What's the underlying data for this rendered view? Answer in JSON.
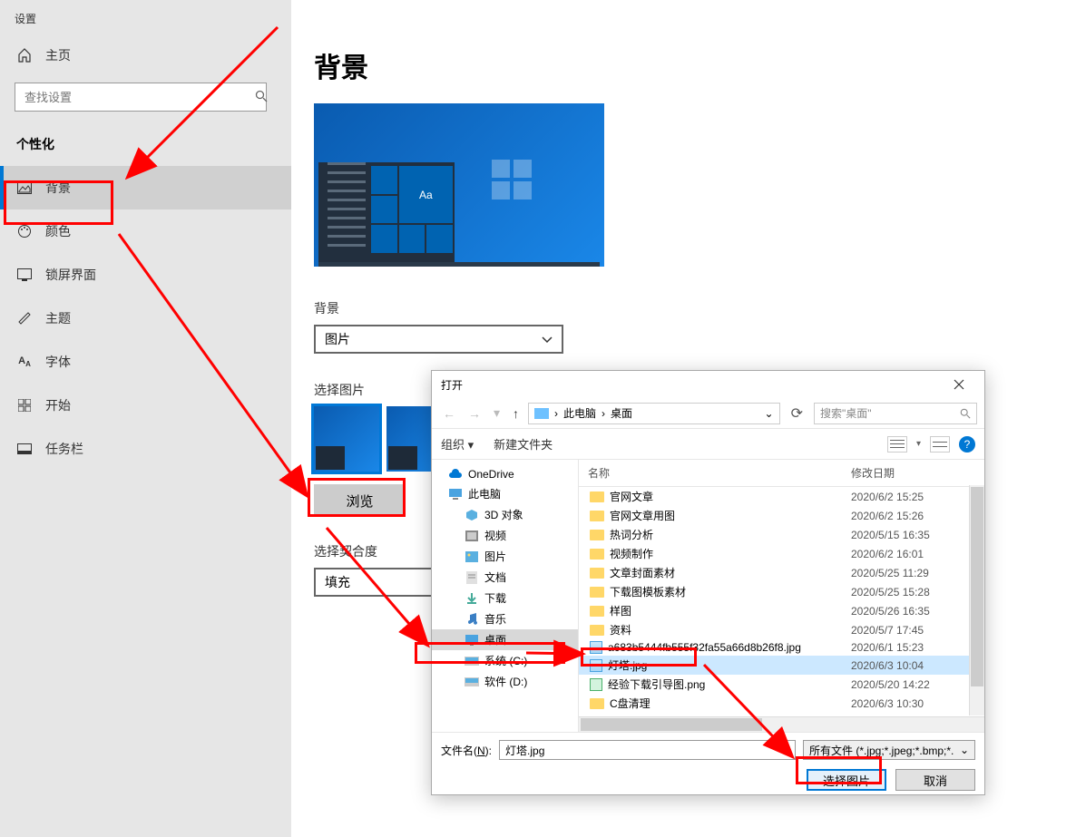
{
  "settings_title": "设置",
  "home_label": "主页",
  "search_placeholder": "查找设置",
  "category": "个性化",
  "nav": [
    {
      "icon": "image-icon",
      "label": "背景"
    },
    {
      "icon": "palette-icon",
      "label": "颜色"
    },
    {
      "icon": "lock-screen-icon",
      "label": "锁屏界面"
    },
    {
      "icon": "theme-icon",
      "label": "主题"
    },
    {
      "icon": "font-icon",
      "label": "字体"
    },
    {
      "icon": "start-icon",
      "label": "开始"
    },
    {
      "icon": "taskbar-icon",
      "label": "任务栏"
    }
  ],
  "page_title": "背景",
  "preview_aa": "Aa",
  "bg_section_label": "背景",
  "bg_dropdown_value": "图片",
  "select_image_label": "选择图片",
  "browse_button": "浏览",
  "fit_label": "选择契合度",
  "fit_dropdown_value": "填充",
  "dialog": {
    "title": "打开",
    "path_segments": [
      "此电脑",
      "桌面"
    ],
    "search_placeholder": "搜索\"桌面\"",
    "organize": "组织",
    "new_folder": "新建文件夹",
    "col_name": "名称",
    "col_date": "修改日期",
    "tree": [
      {
        "type": "cloud",
        "label": "OneDrive"
      },
      {
        "type": "pc",
        "label": "此电脑"
      },
      {
        "type": "3d",
        "label": "3D 对象",
        "indent": true
      },
      {
        "type": "video",
        "label": "视频",
        "indent": true
      },
      {
        "type": "pictures",
        "label": "图片",
        "indent": true
      },
      {
        "type": "docs",
        "label": "文档",
        "indent": true
      },
      {
        "type": "download",
        "label": "下载",
        "indent": true
      },
      {
        "type": "music",
        "label": "音乐",
        "indent": true
      },
      {
        "type": "desktop",
        "label": "桌面",
        "indent": true,
        "selected": true
      },
      {
        "type": "disk",
        "label": "系统 (C:)",
        "indent": true
      },
      {
        "type": "disk",
        "label": "软件 (D:)",
        "indent": true
      }
    ],
    "files": [
      {
        "type": "folder",
        "name": "官网文章",
        "date": "2020/6/2 15:25"
      },
      {
        "type": "folder",
        "name": "官网文章用图",
        "date": "2020/6/2 15:26"
      },
      {
        "type": "folder",
        "name": "热词分析",
        "date": "2020/5/15 16:35"
      },
      {
        "type": "folder",
        "name": "视频制作",
        "date": "2020/6/2 16:01"
      },
      {
        "type": "folder",
        "name": "文章封面素材",
        "date": "2020/5/25 11:29"
      },
      {
        "type": "folder",
        "name": "下载图模板素材",
        "date": "2020/5/25 15:28"
      },
      {
        "type": "folder",
        "name": "样图",
        "date": "2020/5/26 16:35"
      },
      {
        "type": "folder",
        "name": "资料",
        "date": "2020/5/7 17:45"
      },
      {
        "type": "jpg",
        "name": "a683b5444fb555f32fa55a66d8b26f8.jpg",
        "date": "2020/6/1 15:23"
      },
      {
        "type": "jpg",
        "name": "灯塔.jpg",
        "date": "2020/6/3 10:04",
        "selected": true
      },
      {
        "type": "png",
        "name": "经验下载引导图.png",
        "date": "2020/5/20 14:22"
      },
      {
        "type": "folder",
        "name": "C盘清理",
        "date": "2020/6/3 10:30"
      }
    ],
    "filename_label_pre": "文件名(",
    "filename_label_u": "N",
    "filename_label_post": "):",
    "filename_value": "灯塔.jpg",
    "filetype_value": "所有文件 (*.jpg;*.jpeg;*.bmp;*.",
    "ok_button": "选择图片",
    "cancel_button": "取消"
  }
}
